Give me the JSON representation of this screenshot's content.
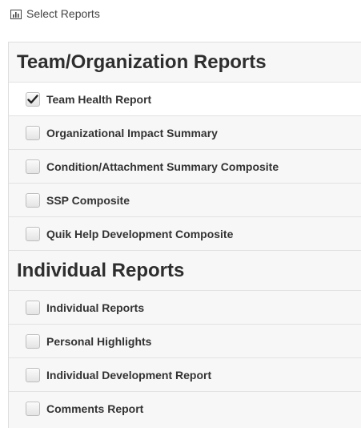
{
  "header": {
    "title": "Select Reports",
    "icon": "bar-chart-icon"
  },
  "sections": [
    {
      "title": "Team/Organization Reports",
      "items": [
        {
          "label": "Team Health Report",
          "checked": true
        },
        {
          "label": "Organizational Impact Summary",
          "checked": false
        },
        {
          "label": "Condition/Attachment Summary Composite",
          "checked": false
        },
        {
          "label": "SSP Composite",
          "checked": false
        },
        {
          "label": "Quik Help Development Composite",
          "checked": false
        }
      ]
    },
    {
      "title": "Individual Reports",
      "items": [
        {
          "label": "Individual Reports",
          "checked": false
        },
        {
          "label": "Personal Highlights",
          "checked": false
        },
        {
          "label": "Individual Development Report",
          "checked": false
        },
        {
          "label": "Comments Report",
          "checked": false
        }
      ]
    }
  ]
}
